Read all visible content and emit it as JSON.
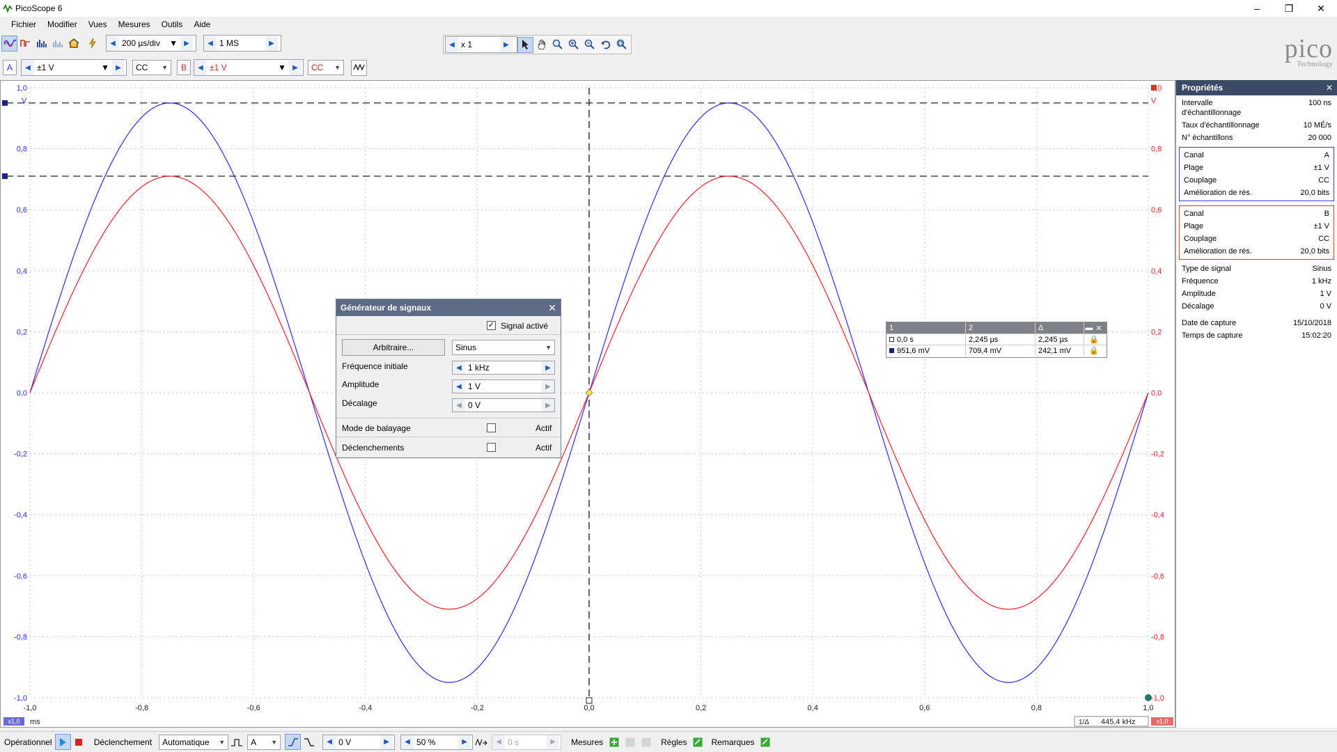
{
  "window": {
    "title": "PicoScope 6",
    "minimize": "–",
    "maximize": "❐",
    "close": "✕"
  },
  "menu": [
    "Fichier",
    "Modifier",
    "Vues",
    "Mesures",
    "Outils",
    "Aide"
  ],
  "toolbar": {
    "timebase": "200 µs/div",
    "samples": "1 MS",
    "zoom": "x 1"
  },
  "brand": {
    "name": "pico",
    "sub": "Technology"
  },
  "channelA": {
    "label": "A",
    "range": "±1 V",
    "coupling": "CC",
    "color": "#2a2aff"
  },
  "channelB": {
    "label": "B",
    "range": "±1 V",
    "coupling": "CC",
    "color": "#e8202a"
  },
  "plot": {
    "y_ticks": [
      "1,0",
      "0,8",
      "0,6",
      "0,4",
      "0,2",
      "0,0",
      "-0,2",
      "-0,4",
      "-0,6",
      "-0,8",
      "-1,0"
    ],
    "x_ticks": [
      "-1,0",
      "-0,8",
      "-0,6",
      "-0,4",
      "-0,2",
      "0,0",
      "0,2",
      "0,4",
      "0,6",
      "0,8",
      "1,0"
    ],
    "y_unit": "V",
    "x_unit": "ms",
    "x_zoom_label": "x1,0",
    "y_zoom_label_right": "x1,0",
    "freq_readout": "1/Δ",
    "freq_value": "445,4 kHz"
  },
  "chart_data": {
    "type": "line",
    "x_unit": "ms",
    "y_unit": "V",
    "xlim": [
      -1.0,
      1.0
    ],
    "ylim": [
      -1.0,
      1.0
    ],
    "grid": true,
    "series": [
      {
        "name": "A",
        "color": "#2a2aff",
        "amplitude": 0.95,
        "frequency_khz": 1,
        "x": [
          -1.0,
          -0.75,
          -0.5,
          -0.25,
          0.0,
          0.25,
          0.5,
          0.75,
          1.0
        ],
        "y": [
          0.0,
          0.95,
          0.0,
          -0.95,
          0.0,
          0.95,
          0.0,
          -0.95,
          0.0
        ]
      },
      {
        "name": "B",
        "color": "#e8202a",
        "amplitude": 0.71,
        "frequency_khz": 1,
        "x": [
          -1.0,
          -0.75,
          -0.5,
          -0.25,
          0.0,
          0.25,
          0.5,
          0.75,
          1.0
        ],
        "y": [
          0.0,
          0.71,
          0.0,
          -0.71,
          0.0,
          0.71,
          0.0,
          -0.71,
          0.0
        ]
      }
    ],
    "rulers": {
      "horizontal": [
        0.95,
        0.71
      ],
      "vertical": [
        0.0
      ]
    }
  },
  "siggen": {
    "title": "Générateur de signaux",
    "signal_active": "Signal activé",
    "arbitrary_button": "Arbitraire...",
    "waveform": "Sinus",
    "start_freq_label": "Fréquence initiale",
    "start_freq": "1 kHz",
    "amplitude_label": "Amplitude",
    "amplitude": "1 V",
    "offset_label": "Décalage",
    "offset": "0 V",
    "sweep_label": "Mode de balayage",
    "sweep_active": "Actif",
    "triggers_label": "Déclenchements",
    "triggers_active": "Actif"
  },
  "measure": {
    "head": [
      "1",
      "2",
      "Δ"
    ],
    "rows": [
      [
        "0,0 s",
        "2,245 µs",
        "2,245 µs"
      ],
      [
        "951,6 mV",
        "709,4 mV",
        "242,1 mV"
      ]
    ]
  },
  "props": {
    "title": "Propriétés",
    "top": [
      {
        "k": "Intervalle d'échantillonnage",
        "v": "100 ns"
      },
      {
        "k": "Taux d'échantillonnage",
        "v": "10 MÉ/s"
      },
      {
        "k": "N° échantillons",
        "v": "20 000"
      }
    ],
    "chA": [
      {
        "k": "Canal",
        "v": "A"
      },
      {
        "k": "Plage",
        "v": "±1 V"
      },
      {
        "k": "Couplage",
        "v": "CC"
      },
      {
        "k": "Amélioration de rés.",
        "v": "20,0 bits"
      }
    ],
    "chB": [
      {
        "k": "Canal",
        "v": "B"
      },
      {
        "k": "Plage",
        "v": "±1 V"
      },
      {
        "k": "Couplage",
        "v": "CC"
      },
      {
        "k": "Amélioration de rés.",
        "v": "20,0 bits"
      }
    ],
    "sig": [
      {
        "k": "Type de signal",
        "v": "Sinus"
      },
      {
        "k": "Fréquence",
        "v": "1 kHz"
      },
      {
        "k": "Amplitude",
        "v": "1 V"
      },
      {
        "k": "Décalage",
        "v": "0 V"
      }
    ],
    "capture": [
      {
        "k": "Date de capture",
        "v": "15/10/2018"
      },
      {
        "k": "Temps de capture",
        "v": "15:02:20"
      }
    ]
  },
  "bottom": {
    "status": "Opérationnel",
    "trigger_label": "Déclenchement",
    "trigger_mode": "Automatique",
    "trigger_channel": "A",
    "threshold": "0 V",
    "pretrigger": "50 %",
    "delay": "0 s",
    "measures": "Mesures",
    "rulers": "Règles",
    "notes": "Remarques"
  }
}
